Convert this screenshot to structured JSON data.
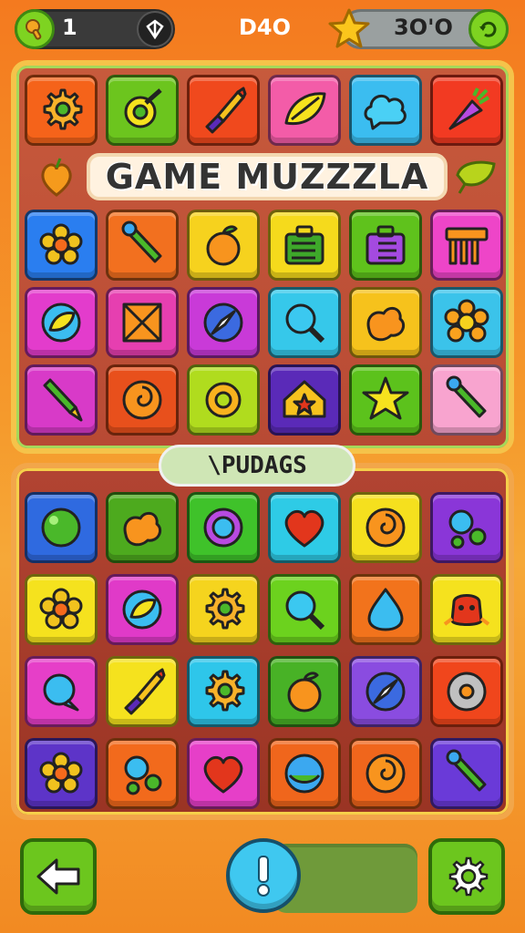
{
  "hud": {
    "lives": "1",
    "center_score": "D4O",
    "stars": "3O'O"
  },
  "title": "GAME MUZZZLA",
  "section_label": "\\PUDAGS",
  "colors": {
    "background": "#f47a1f",
    "accent_green": "#7ed321",
    "accent_blue": "#3fc8f0",
    "board_top": "#c6543a",
    "board_bottom": "#a43a2a"
  },
  "top_grid": [
    [
      {
        "color": "#f5631a",
        "icon": "gear-icon"
      },
      {
        "color": "#6cc51e",
        "icon": "lemon-icon"
      },
      {
        "color": "#f0491d",
        "icon": "paintbrush-icon"
      },
      {
        "color": "#f35ca8",
        "icon": "leaf-icon"
      },
      {
        "color": "#3bbdf0",
        "icon": "cloud-icon"
      },
      {
        "color": "#f23a22",
        "icon": "carrot-icon"
      }
    ],
    [
      {
        "color": "#2a7ef0",
        "icon": "flower-icon"
      },
      {
        "color": "#f2701f",
        "icon": "wand-icon"
      },
      {
        "color": "#f6d21e",
        "icon": "orange-icon"
      },
      {
        "color": "#f5da1c",
        "icon": "lunchbox-icon"
      },
      {
        "color": "#5fc21c",
        "icon": "toolbox-icon"
      },
      {
        "color": "#ee45c8",
        "icon": "table-icon"
      }
    ],
    [
      {
        "color": "#e33ccc",
        "icon": "leaf-badge-icon"
      },
      {
        "color": "#e63fb0",
        "icon": "crate-icon"
      },
      {
        "color": "#c93ad8",
        "icon": "compass-icon"
      },
      {
        "color": "#36c8ea",
        "icon": "magnifier-icon"
      },
      {
        "color": "#f6c21c",
        "icon": "blob-icon"
      },
      {
        "color": "#3bc3ea",
        "icon": "sunflower-icon"
      }
    ],
    [
      {
        "color": "#d83ac8",
        "icon": "pencil-icon"
      },
      {
        "color": "#e8501c",
        "icon": "swirl-icon"
      },
      {
        "color": "#b0dc1e",
        "icon": "cog-icon"
      },
      {
        "color": "#5a2ab8",
        "icon": "house-star-icon"
      },
      {
        "color": "#5cc21c",
        "icon": "star-icon"
      },
      {
        "color": "#f8a4cf",
        "icon": "wand-icon"
      }
    ]
  ],
  "bottom_grid": [
    [
      {
        "color": "#2f6ae0",
        "icon": "ball-icon"
      },
      {
        "color": "#4daa1e",
        "icon": "blob-icon"
      },
      {
        "color": "#3fc22a",
        "icon": "ring-icon"
      },
      {
        "color": "#2ecbe6",
        "icon": "heart-icon"
      },
      {
        "color": "#f5e01e",
        "icon": "swirl-icon"
      },
      {
        "color": "#8a36d8",
        "icon": "bubbles-icon"
      }
    ],
    [
      {
        "color": "#f5e21e",
        "icon": "flower-icon"
      },
      {
        "color": "#e03ac8",
        "icon": "leaf-badge-icon"
      },
      {
        "color": "#f5d41e",
        "icon": "gear-icon"
      },
      {
        "color": "#6cd21e",
        "icon": "magnifier-icon"
      },
      {
        "color": "#f2731c",
        "icon": "drop-icon"
      },
      {
        "color": "#f5e21e",
        "icon": "creature-icon"
      }
    ],
    [
      {
        "color": "#e63fc8",
        "icon": "bubble-icon"
      },
      {
        "color": "#f5e21e",
        "icon": "paintbrush-icon"
      },
      {
        "color": "#2ec6ea",
        "icon": "gear-icon"
      },
      {
        "color": "#48b226",
        "icon": "orange-icon"
      },
      {
        "color": "#8a4ce0",
        "icon": "compass-icon"
      },
      {
        "color": "#f0461c",
        "icon": "saw-icon"
      }
    ],
    [
      {
        "color": "#5d34c8",
        "icon": "flower-icon"
      },
      {
        "color": "#f26a1c",
        "icon": "bubbles-icon"
      },
      {
        "color": "#e63fc8",
        "icon": "heart-icon"
      },
      {
        "color": "#f0661c",
        "icon": "orb-icon"
      },
      {
        "color": "#f0661c",
        "icon": "swirl-icon"
      },
      {
        "color": "#6a3ad8",
        "icon": "wand-icon"
      }
    ]
  ]
}
